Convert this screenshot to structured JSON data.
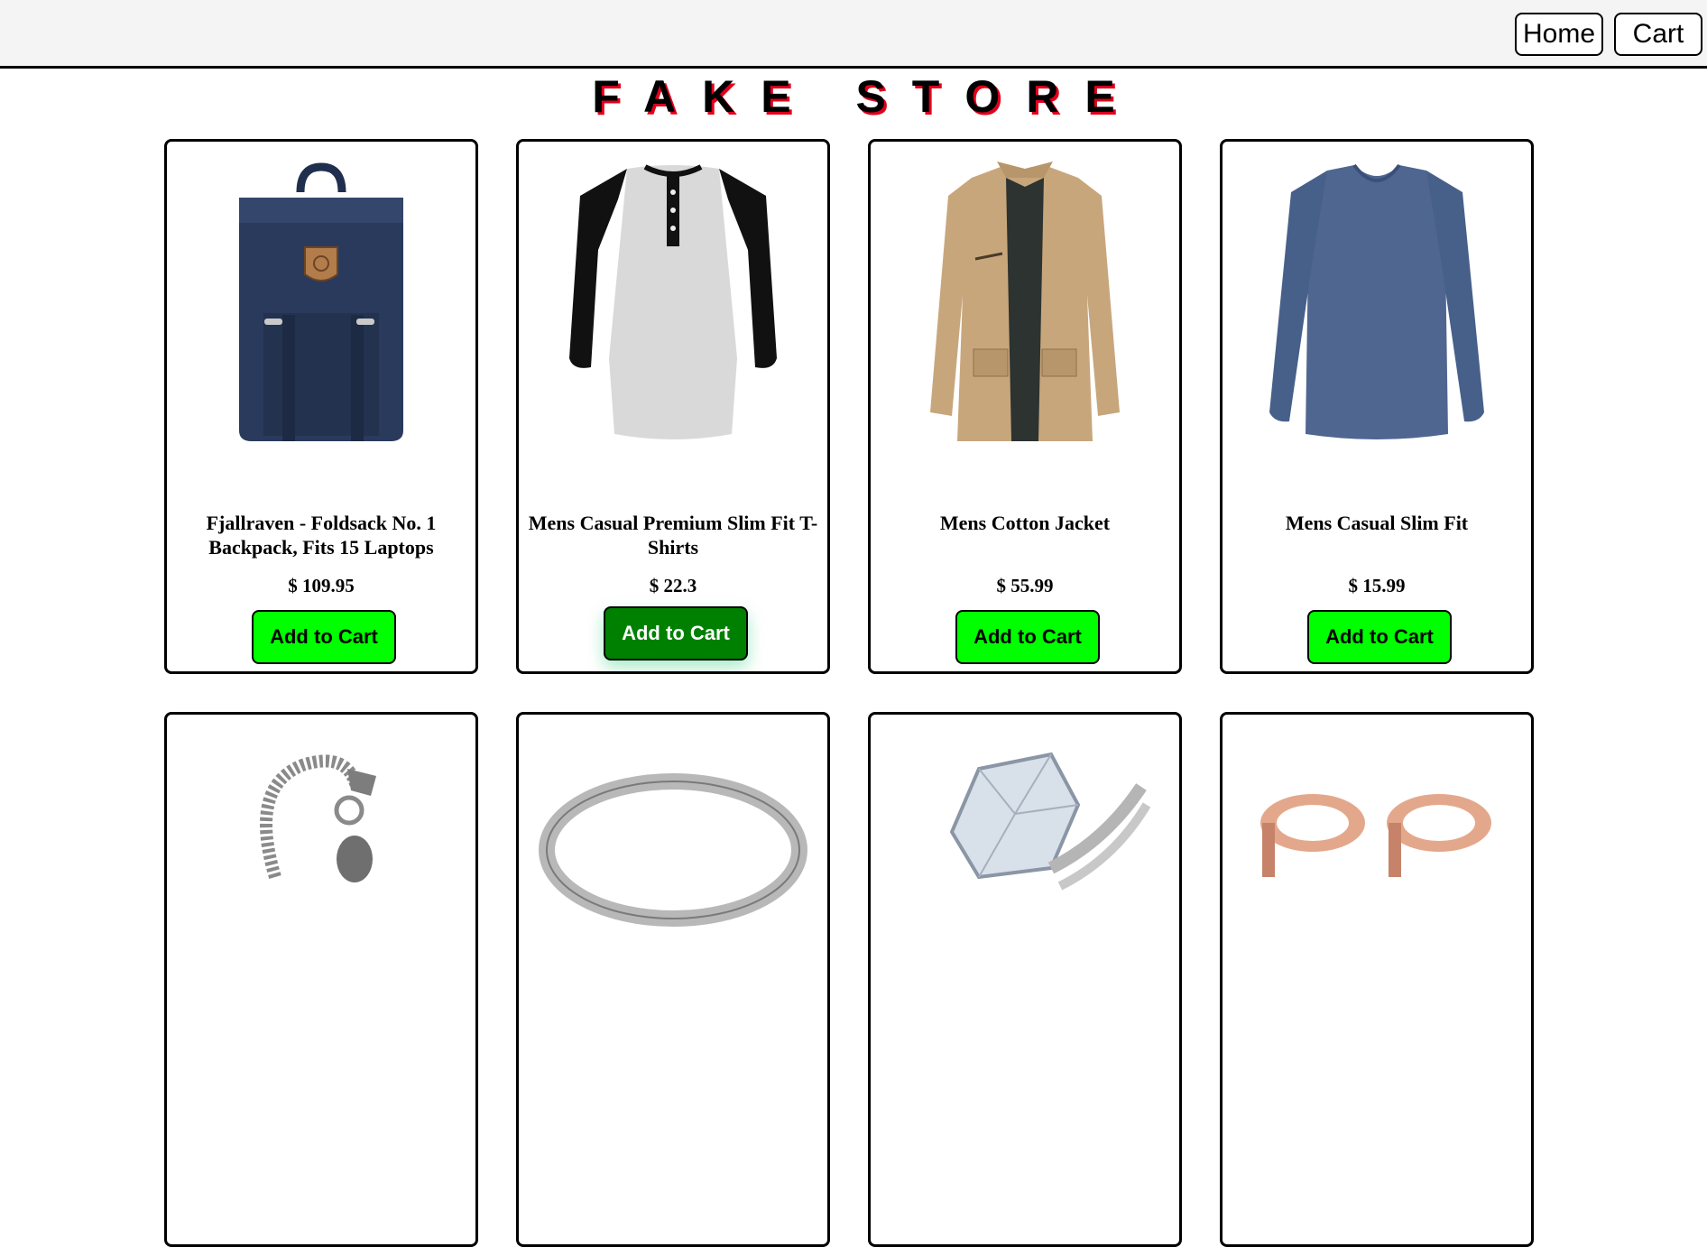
{
  "nav": {
    "home_label": "Home",
    "cart_label": "Cart"
  },
  "store": {
    "title": "FAKE STORE"
  },
  "products": [
    {
      "title": "Fjallraven - Foldsack No. 1 Backpack, Fits 15 Laptops",
      "price": "$ 109.95",
      "button": "Add to Cart",
      "image": "backpack-image"
    },
    {
      "title": "Mens Casual Premium Slim Fit T-Shirts",
      "price": "$ 22.3",
      "button": "Add to Cart",
      "image": "raglan-tshirt-image"
    },
    {
      "title": "Mens Cotton Jacket",
      "price": "$ 55.99",
      "button": "Add to Cart",
      "image": "cotton-jacket-image"
    },
    {
      "title": "Mens Casual Slim Fit",
      "price": "$ 15.99",
      "button": "Add to Cart",
      "image": "long-sleeve-shirt-image"
    },
    {
      "image": "dragon-bracelet-image"
    },
    {
      "image": "silver-ring-image"
    },
    {
      "image": "diamond-ring-image"
    },
    {
      "image": "rose-gold-plugs-image"
    }
  ],
  "colors": {
    "button": "#00ff00",
    "button_hover": "#008000",
    "title_shadow": "#e0001a"
  }
}
